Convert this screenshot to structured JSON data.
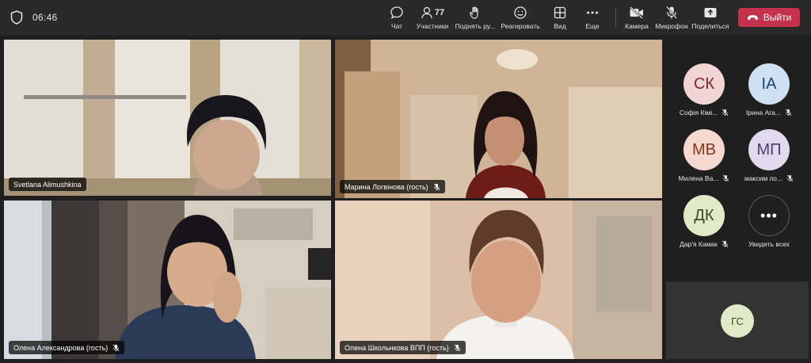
{
  "meeting": {
    "timer": "06:46"
  },
  "toolbar": {
    "chat": {
      "label": "Чат",
      "icon": "chat-icon"
    },
    "participants": {
      "label": "Участники",
      "count": "77",
      "icon": "people-icon"
    },
    "raise_hand": {
      "label": "Поднять ру...",
      "icon": "hand-icon"
    },
    "react": {
      "label": "Реагировать",
      "icon": "smile-icon"
    },
    "view": {
      "label": "Вид",
      "icon": "grid-icon"
    },
    "more": {
      "label": "Еще",
      "icon": "more-icon"
    },
    "camera": {
      "label": "Камера",
      "icon": "camera-off-icon"
    },
    "mic": {
      "label": "Микрофон",
      "icon": "mic-off-icon"
    },
    "share": {
      "label": "Поделиться",
      "icon": "share-icon"
    },
    "leave": {
      "label": "Выйти",
      "icon": "phone-hangup-icon",
      "color": "#c4314b"
    }
  },
  "videos": [
    {
      "name": "Svetlana Alimushkina"
    },
    {
      "name": "Марина Логвінова (гость)"
    },
    {
      "name": "Олена Александрова (гость)"
    },
    {
      "name": "Олена Школьнкова ВПП (гость)"
    }
  ],
  "participants": [
    {
      "initials": "СК",
      "name": "Софія Кімі...",
      "bg": "#f1d4d4",
      "fg": "#7a2b2b"
    },
    {
      "initials": "ІА",
      "name": "Ірина Ага...",
      "bg": "#cfe0f2",
      "fg": "#1f4470"
    },
    {
      "initials": "МВ",
      "name": "Милена Ва...",
      "bg": "#f5d8cf",
      "fg": "#8a3418"
    },
    {
      "initials": "МП",
      "name": "максим по...",
      "bg": "#e1d9ee",
      "fg": "#4b3a6b"
    },
    {
      "initials": "ДК",
      "name": "Дар'я Камак",
      "bg": "#e1e9c8",
      "fg": "#3b4a1e"
    }
  ],
  "see_all": {
    "label": "Увидеть всех",
    "icon": "more-icon"
  },
  "guest": {
    "initials": "ГС"
  },
  "colors": {
    "accent": "#7f85f5",
    "topbar": "#292929",
    "background": "#1f1f1f"
  }
}
